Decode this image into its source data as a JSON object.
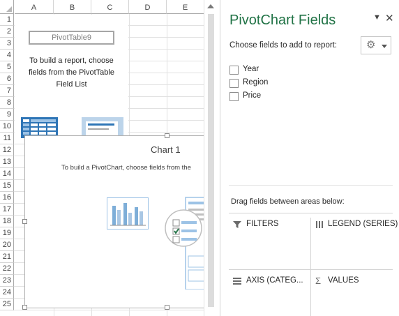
{
  "sheet": {
    "columns": [
      "A",
      "B",
      "C",
      "D",
      "E"
    ],
    "rows": [
      "1",
      "2",
      "3",
      "4",
      "5",
      "6",
      "7",
      "8",
      "9",
      "10",
      "11",
      "12",
      "13",
      "14",
      "15",
      "16",
      "17",
      "18",
      "19",
      "20",
      "21",
      "22",
      "23",
      "24",
      "25"
    ]
  },
  "pivot_table": {
    "name": "PivotTable9",
    "help_lines": [
      "To build a report, choose",
      "fields from the PivotTable",
      "Field List"
    ]
  },
  "chart": {
    "title": "Chart 1",
    "help": "To build a PivotChart, choose fields from the"
  },
  "pane": {
    "title": "PivotChart Fields",
    "choose_label": "Choose fields to add to report:",
    "tools_icon": "gear-icon",
    "fields": [
      {
        "label": "Year",
        "checked": false
      },
      {
        "label": "Region",
        "checked": false
      },
      {
        "label": "Price",
        "checked": false
      }
    ],
    "drag_label": "Drag fields between areas below:",
    "areas": {
      "filters": "FILTERS",
      "legend": "LEGEND (SERIES)",
      "axis": "AXIS (CATEG...",
      "values": "VALUES"
    }
  },
  "colors": {
    "accent": "#217346",
    "chart_bar": "#7eaed8",
    "list_highlight": "#bcd4ea"
  }
}
